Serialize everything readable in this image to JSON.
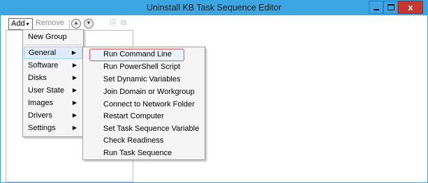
{
  "window": {
    "title": "Uninstall KB Task Sequence Editor",
    "close_glyph": "x"
  },
  "toolbar": {
    "add_label": "Add",
    "add_caret": "▾",
    "remove_label": "Remove",
    "move_up_glyph": "▲",
    "move_down_glyph": "▼",
    "icon_a": "⎘",
    "icon_b": "⧉"
  },
  "menu": {
    "items": [
      {
        "label": "New Group",
        "has_submenu": false
      },
      {
        "label": "General",
        "has_submenu": true,
        "active": true
      },
      {
        "label": "Software",
        "has_submenu": true
      },
      {
        "label": "Disks",
        "has_submenu": true
      },
      {
        "label": "User State",
        "has_submenu": true
      },
      {
        "label": "Images",
        "has_submenu": true
      },
      {
        "label": "Drivers",
        "has_submenu": true
      },
      {
        "label": "Settings",
        "has_submenu": true
      }
    ],
    "arrow_glyph": "▶"
  },
  "submenu": {
    "items": [
      {
        "label": "Run Command Line",
        "highlighted": true
      },
      {
        "label": "Run PowerShell Script"
      },
      {
        "label": "Set Dynamic Variables"
      },
      {
        "label": "Join Domain or Workgroup"
      },
      {
        "label": "Connect to Network Folder"
      },
      {
        "label": "Restart Computer"
      },
      {
        "label": "Set Task Sequence Variable"
      },
      {
        "label": "Check Readiness"
      },
      {
        "label": "Run Task Sequence"
      }
    ],
    "highlight_color": "#d9534f"
  },
  "colors": {
    "titlebar": "#3aa6e3",
    "close_button": "#c7372f"
  }
}
